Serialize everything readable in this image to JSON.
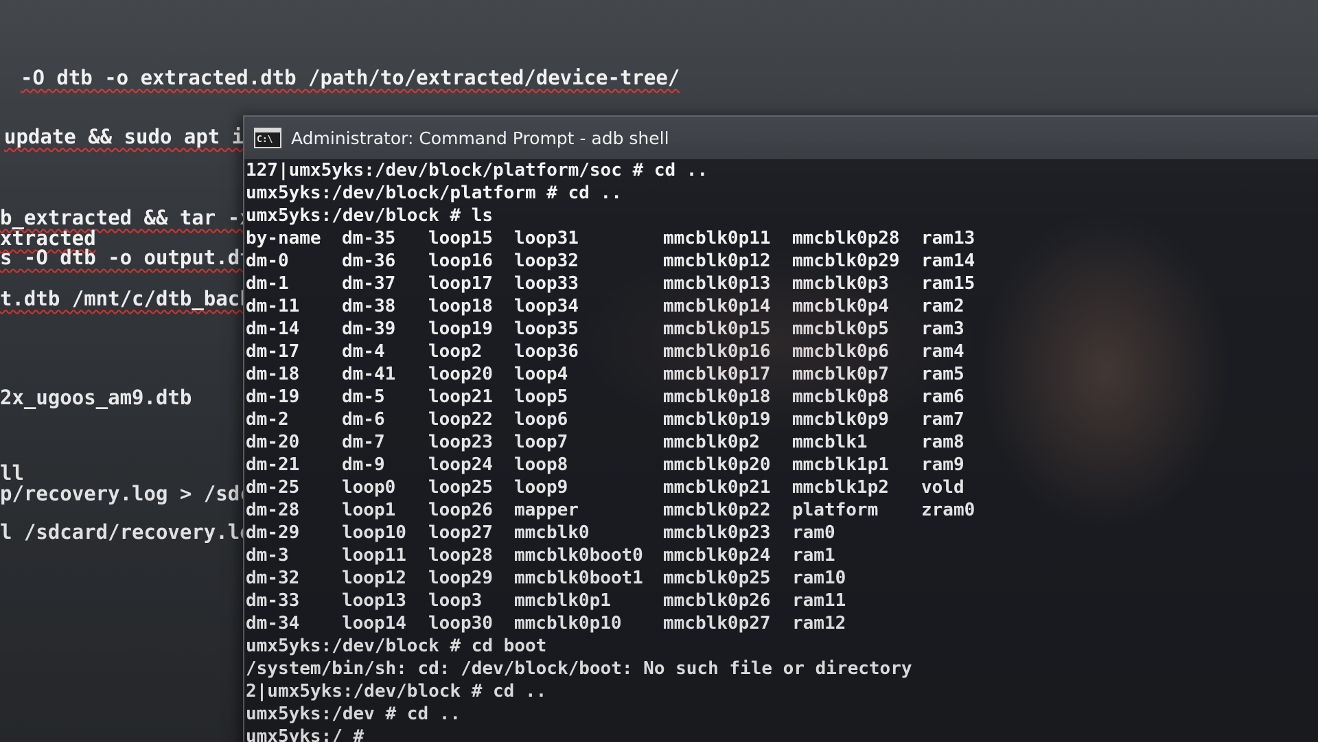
{
  "background_editor": {
    "lines": [
      "-O dtb -o extracted.dtb /path/to/extracted/device-tree/",
      "update && sudo apt i",
      "b_extracted && tar -x",
      "xtracted",
      "s -O dtb -o output.dtb",
      "t.dtb /mnt/c/dtb_backu",
      "2x_ugoos_am9.dtb",
      "ll",
      "p/recovery.log > /sdca",
      "l /sdcard/recovery.log"
    ]
  },
  "window": {
    "icon_label": "C:\\",
    "title": "Administrator: Command Prompt - adb  shell"
  },
  "terminal": {
    "pre_lines": [
      "127|umx5yks:/dev/block/platform/soc # cd ..",
      "umx5yks:/dev/block/platform # cd ..",
      "umx5yks:/dev/block # ls"
    ],
    "ls_rows": [
      [
        "by-name",
        "dm-35",
        "loop15",
        "loop31",
        "mmcblk0p11",
        "mmcblk0p28",
        "ram13"
      ],
      [
        "dm-0",
        "dm-36",
        "loop16",
        "loop32",
        "mmcblk0p12",
        "mmcblk0p29",
        "ram14"
      ],
      [
        "dm-1",
        "dm-37",
        "loop17",
        "loop33",
        "mmcblk0p13",
        "mmcblk0p3",
        "ram15"
      ],
      [
        "dm-11",
        "dm-38",
        "loop18",
        "loop34",
        "mmcblk0p14",
        "mmcblk0p4",
        "ram2"
      ],
      [
        "dm-14",
        "dm-39",
        "loop19",
        "loop35",
        "mmcblk0p15",
        "mmcblk0p5",
        "ram3"
      ],
      [
        "dm-17",
        "dm-4",
        "loop2",
        "loop36",
        "mmcblk0p16",
        "mmcblk0p6",
        "ram4"
      ],
      [
        "dm-18",
        "dm-41",
        "loop20",
        "loop4",
        "mmcblk0p17",
        "mmcblk0p7",
        "ram5"
      ],
      [
        "dm-19",
        "dm-5",
        "loop21",
        "loop5",
        "mmcblk0p18",
        "mmcblk0p8",
        "ram6"
      ],
      [
        "dm-2",
        "dm-6",
        "loop22",
        "loop6",
        "mmcblk0p19",
        "mmcblk0p9",
        "ram7"
      ],
      [
        "dm-20",
        "dm-7",
        "loop23",
        "loop7",
        "mmcblk0p2",
        "mmcblk1",
        "ram8"
      ],
      [
        "dm-21",
        "dm-9",
        "loop24",
        "loop8",
        "mmcblk0p20",
        "mmcblk1p1",
        "ram9"
      ],
      [
        "dm-25",
        "loop0",
        "loop25",
        "loop9",
        "mmcblk0p21",
        "mmcblk1p2",
        "vold"
      ],
      [
        "dm-28",
        "loop1",
        "loop26",
        "mapper",
        "mmcblk0p22",
        "platform",
        "zram0"
      ],
      [
        "dm-29",
        "loop10",
        "loop27",
        "mmcblk0",
        "mmcblk0p23",
        "ram0",
        ""
      ],
      [
        "dm-3",
        "loop11",
        "loop28",
        "mmcblk0boot0",
        "mmcblk0p24",
        "ram1",
        ""
      ],
      [
        "dm-32",
        "loop12",
        "loop29",
        "mmcblk0boot1",
        "mmcblk0p25",
        "ram10",
        ""
      ],
      [
        "dm-33",
        "loop13",
        "loop3",
        "mmcblk0p1",
        "mmcblk0p26",
        "ram11",
        ""
      ],
      [
        "dm-34",
        "loop14",
        "loop30",
        "mmcblk0p10",
        "mmcblk0p27",
        "ram12",
        ""
      ]
    ],
    "post_lines": [
      "umx5yks:/dev/block # cd boot",
      "/system/bin/sh: cd: /dev/block/boot: No such file or directory",
      "2|umx5yks:/dev/block # cd ..",
      "umx5yks:/dev # cd ..",
      "umx5yks:/ #"
    ]
  }
}
